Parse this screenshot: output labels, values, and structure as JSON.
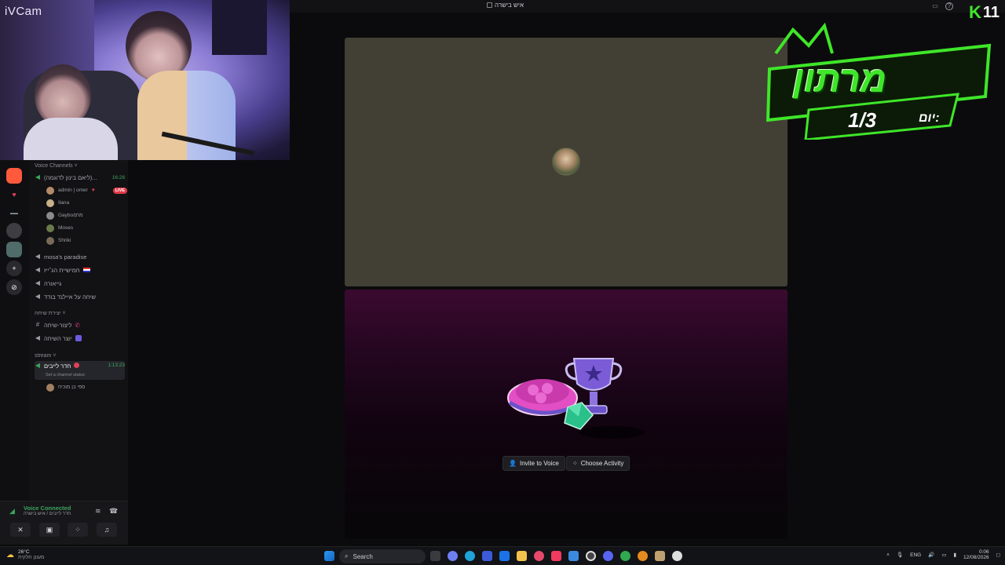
{
  "window": {
    "title": "איש בישרה"
  },
  "webcam": {
    "label": "iVCam"
  },
  "overlay": {
    "corner_number": "11",
    "logo_text": "מרתון",
    "day_label": "יום:",
    "day_value": "1/3"
  },
  "sidebar": {
    "voice_category": "Voice Channels",
    "channels": [
      {
        "name": "(ליאם בינון לדוגמה)...",
        "time": "16:28"
      },
      {
        "name": "mosa's paradise"
      },
      {
        "name": "חמישיית הג׳ייז"
      },
      {
        "name": "גייאורה"
      },
      {
        "name": "שיחה על איילנד בודד"
      }
    ],
    "members": [
      {
        "name": "admin | omer",
        "badge": "LIVE"
      },
      {
        "name": "Ilana"
      },
      {
        "name": "Gaybo/מתן"
      },
      {
        "name": "Moses"
      },
      {
        "name": "Shriki"
      }
    ],
    "create_category": "יצירת שיחה",
    "create_channels": [
      {
        "name": "ליצור-שיחה"
      },
      {
        "name": "יוצר השיחה"
      }
    ],
    "stream_category": "stream",
    "stream_channel": {
      "name": "חדר לייבים",
      "time": "1:13:23",
      "status": "Set a channel status"
    },
    "stream_member": "ספי בן מוכיח"
  },
  "voicebar": {
    "status": "Voice Connected",
    "sub": "חדר לייבים / איש בישרה"
  },
  "stage": {
    "invite_label": "Invite to Voice",
    "activity_label": "Choose Activity"
  },
  "taskbar": {
    "search_placeholder": "Search",
    "weather_temp": "26°C",
    "weather_desc": "מעונן חלקית",
    "lang": "ENG",
    "time": "0:06",
    "date": "12/08/2026"
  },
  "colors": {
    "accent_green": "#3ba55d",
    "live_red": "#e23b4a",
    "logo_green": "#3fe629"
  }
}
